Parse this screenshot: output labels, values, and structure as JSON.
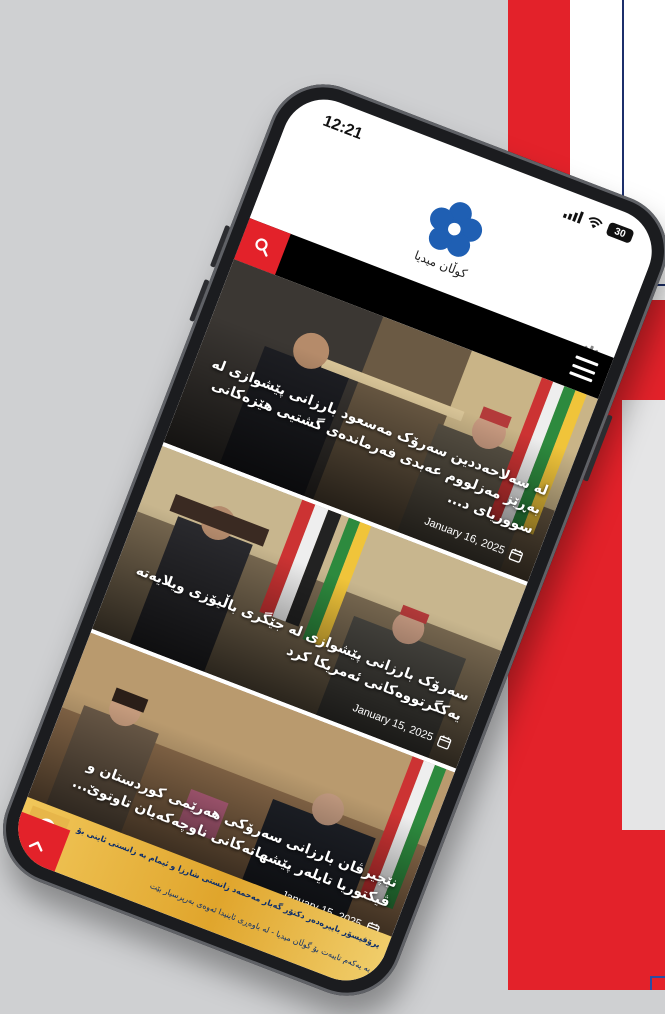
{
  "status_bar": {
    "time": "12:21",
    "battery_level": "30"
  },
  "site": {
    "logo_text": "کوڵان میدیا",
    "brand_color": "#e3222a",
    "logo_color": "#1f5fb3",
    "icons": {
      "search": "search-icon",
      "menu": "hamburger-menu-icon",
      "settings": "gear-icon",
      "back_to_top": "chevron-up-icon",
      "date": "calendar-icon"
    }
  },
  "articles": [
    {
      "title": "لە سەلاحەددین سەرۆک مەسعود بارزانی پێشوازی لە بەڕێز مەزلووم عەبدی فەرماندەی گشتیی هێزەکانی سووریای د...",
      "date": "January 16, 2025"
    },
    {
      "title": "سەرۆک بارزانی پێشوازی لە جێگری باڵیۆزی ویلایەتە یەکگرتووەکانی ئەمریکا کرد",
      "date": "January 15, 2025"
    },
    {
      "title": "نێچیرڤان بارزانی سەرۆکی هەرێمی کوردستان و ڤیکتوریا تایلەر پێشهاتەکانی ناوچەکەیان تاوتوێ...",
      "date": "January 15, 2025"
    }
  ],
  "banner": {
    "line1": "پرۆفیسۆر باپیرەدەر دکتۆر گەبار مەحمەد زانستی شارزا و ئیمام بە زانستی ئاینی بۆ گوڵان",
    "line2": "بە یەکەم تایبەت بۆ گوڵان میدیا - لە باوەڕی ئاینیدا ئەوەی بەرپرسیار بێت"
  }
}
